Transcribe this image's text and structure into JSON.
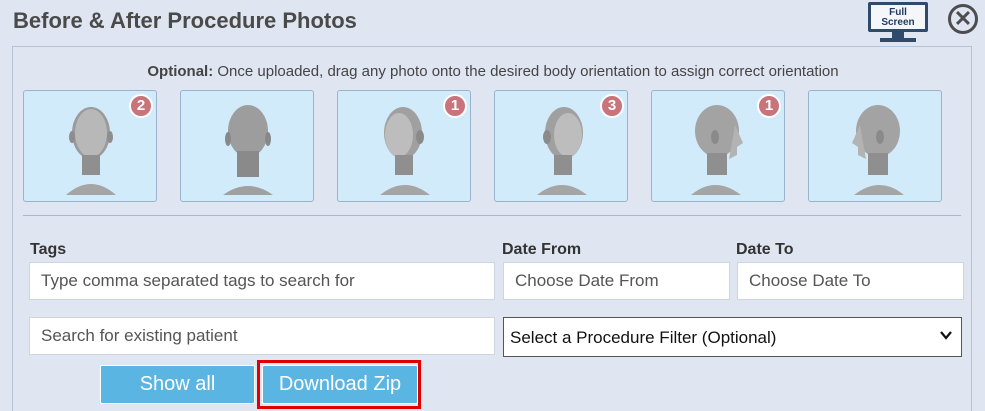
{
  "header": {
    "title": "Before & After Procedure Photos",
    "fullscreen_line1": "Full",
    "fullscreen_line2": "Screen",
    "close_symbol": "✕"
  },
  "instructions": {
    "bold": "Optional:",
    "text": " Once uploaded, drag any photo onto the desired body orientation to assign correct orientation"
  },
  "orientations": [
    {
      "name": "front",
      "badge": "2"
    },
    {
      "name": "back",
      "badge": ""
    },
    {
      "name": "three-quarter-right",
      "badge": "1"
    },
    {
      "name": "three-quarter-left",
      "badge": "3"
    },
    {
      "name": "profile-right",
      "badge": "1"
    },
    {
      "name": "profile-left",
      "badge": ""
    }
  ],
  "filters": {
    "tags_label": "Tags",
    "tags_placeholder": "Type comma separated tags to search for",
    "date_from_label": "Date From",
    "date_from_placeholder": "Choose Date From",
    "date_to_label": "Date To",
    "date_to_placeholder": "Choose Date To",
    "patient_placeholder": "Search for existing patient",
    "procedure_select": "Select a Procedure Filter (Optional)"
  },
  "buttons": {
    "show_all": "Show all",
    "download_zip": "Download Zip"
  },
  "colors": {
    "background": "#dfe6f2",
    "thumb_bg": "#d2ebfb",
    "badge": "#c9737a",
    "button": "#5ab5e2",
    "highlight": "#e00000"
  }
}
